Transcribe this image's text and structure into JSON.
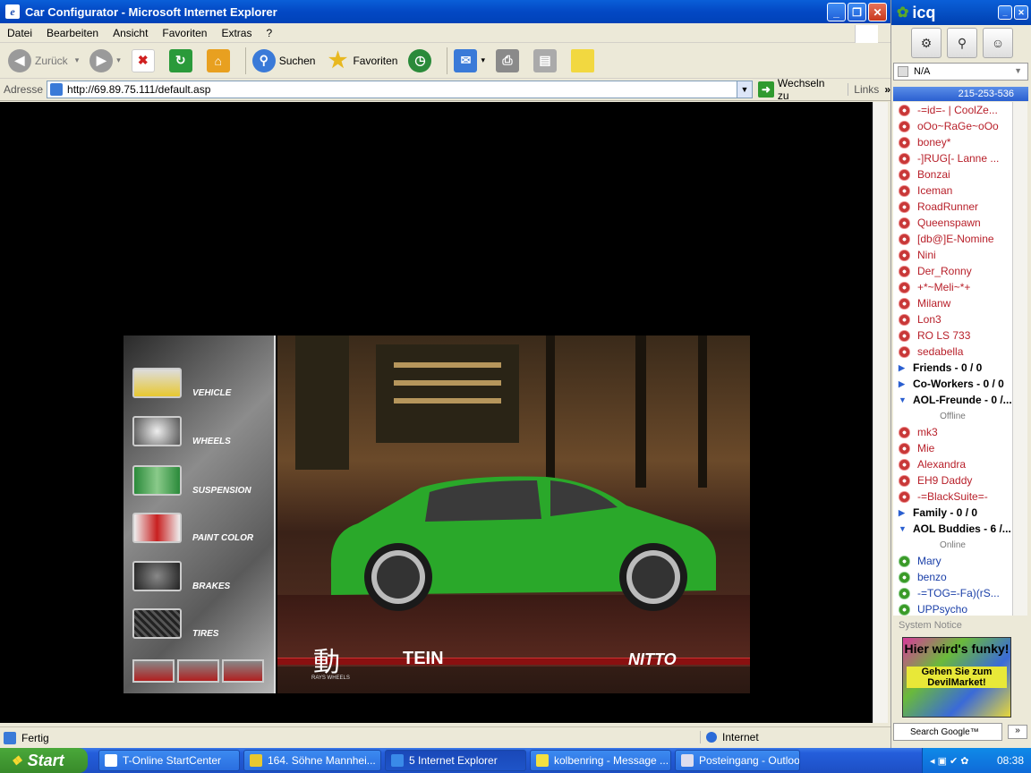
{
  "ie": {
    "title": "Car Configurator - Microsoft Internet Explorer",
    "menu": [
      "Datei",
      "Bearbeiten",
      "Ansicht",
      "Favoriten",
      "Extras",
      "?"
    ],
    "toolbar": {
      "back": "Zurück",
      "search": "Suchen",
      "favorites": "Favoriten"
    },
    "address_label": "Adresse",
    "url": "http://69.89.75.111/default.asp",
    "go_label": "Wechseln zu",
    "links_label": "Links",
    "status_left": "Fertig",
    "status_zone": "Internet"
  },
  "configurator": {
    "menu": [
      "VEHICLE",
      "WHEELS",
      "SUSPENSION",
      "PAINT COLOR",
      "BRAKES",
      "TIRES"
    ],
    "brands": {
      "rays": "RAYS WHEELS",
      "tein": "TEIN",
      "nitto": "NITTO"
    },
    "car_color": "#2aa82a"
  },
  "icq": {
    "title": "icq",
    "status": "N/A",
    "uin": "215-253-536",
    "contacts": [
      {
        "name": "-=id=- | CoolZe...",
        "type": "off"
      },
      {
        "name": "oOo~RaGe~oOo",
        "type": "off"
      },
      {
        "name": "boney*",
        "type": "off"
      },
      {
        "name": "-]RUG[- Lanne ...",
        "type": "off"
      },
      {
        "name": "Bonzai",
        "type": "off"
      },
      {
        "name": "Iceman",
        "type": "off"
      },
      {
        "name": "RoadRunner",
        "type": "off"
      },
      {
        "name": "Queenspawn",
        "type": "off"
      },
      {
        "name": "[db@]E-Nomine",
        "type": "off"
      },
      {
        "name": "Nini",
        "type": "off"
      },
      {
        "name": "Der_Ronny",
        "type": "off"
      },
      {
        "name": "+*~Meli~*+",
        "type": "off"
      },
      {
        "name": "Milanw",
        "type": "off"
      },
      {
        "name": " Lon3",
        "type": "off"
      },
      {
        "name": "RO LS 733",
        "type": "off"
      },
      {
        "name": "sedabella",
        "type": "off"
      },
      {
        "name": "Friends  -  0 / 0",
        "type": "grp",
        "open": false
      },
      {
        "name": "Co-Workers  -  0 / 0",
        "type": "grp",
        "open": false
      },
      {
        "name": "AOL-Freunde  -  0 /...",
        "type": "grp",
        "open": true
      },
      {
        "name": "Offline",
        "type": "div"
      },
      {
        "name": "mk3",
        "type": "off"
      },
      {
        "name": "Mie",
        "type": "off"
      },
      {
        "name": "Alexandra",
        "type": "off"
      },
      {
        "name": "EH9 Daddy",
        "type": "off"
      },
      {
        "name": "-=BlackSuite=-",
        "type": "off"
      },
      {
        "name": "Family  -  0 / 0",
        "type": "grp",
        "open": false
      },
      {
        "name": "AOL Buddies  -  6 /...",
        "type": "grp",
        "open": true
      },
      {
        "name": "Online",
        "type": "div"
      },
      {
        "name": "Mary",
        "type": "on"
      },
      {
        "name": "benzo",
        "type": "on"
      },
      {
        "name": "-=TOG=-Fa)(rS...",
        "type": "on"
      },
      {
        "name": "UPPsycho",
        "type": "on"
      }
    ],
    "system_notice": "System Notice",
    "ad_line1": "Hier wird's funky!",
    "ad_line2": "Gehen Sie zum DevilMarket!",
    "search_label": "Search Google™"
  },
  "taskbar": {
    "start": "Start",
    "tasks": [
      {
        "label": "T-Online StartCenter",
        "active": false
      },
      {
        "label": "164. Söhne Mannhei...",
        "active": false
      },
      {
        "label": "5 Internet Explorer",
        "active": true
      },
      {
        "label": "kolbenring - Message ...",
        "active": false
      },
      {
        "label": "Posteingang - Outloo...",
        "active": false
      }
    ],
    "clock": "08:38"
  }
}
